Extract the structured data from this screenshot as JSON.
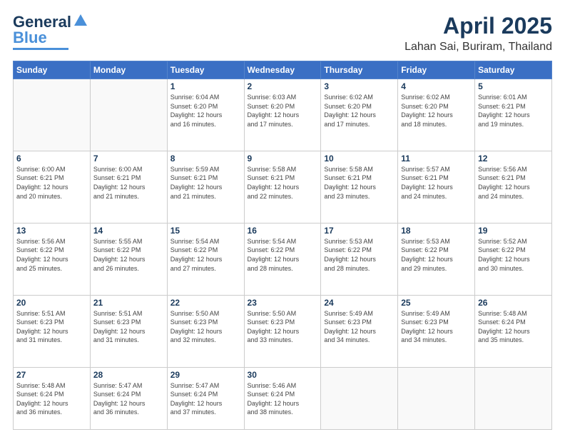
{
  "header": {
    "logo_line1": "General",
    "logo_line2": "Blue",
    "main_title": "April 2025",
    "subtitle": "Lahan Sai, Buriram, Thailand"
  },
  "weekdays": [
    "Sunday",
    "Monday",
    "Tuesday",
    "Wednesday",
    "Thursday",
    "Friday",
    "Saturday"
  ],
  "weeks": [
    {
      "days": [
        {
          "num": "",
          "info": ""
        },
        {
          "num": "",
          "info": ""
        },
        {
          "num": "1",
          "info": "Sunrise: 6:04 AM\nSunset: 6:20 PM\nDaylight: 12 hours\nand 16 minutes."
        },
        {
          "num": "2",
          "info": "Sunrise: 6:03 AM\nSunset: 6:20 PM\nDaylight: 12 hours\nand 17 minutes."
        },
        {
          "num": "3",
          "info": "Sunrise: 6:02 AM\nSunset: 6:20 PM\nDaylight: 12 hours\nand 17 minutes."
        },
        {
          "num": "4",
          "info": "Sunrise: 6:02 AM\nSunset: 6:20 PM\nDaylight: 12 hours\nand 18 minutes."
        },
        {
          "num": "5",
          "info": "Sunrise: 6:01 AM\nSunset: 6:21 PM\nDaylight: 12 hours\nand 19 minutes."
        }
      ]
    },
    {
      "days": [
        {
          "num": "6",
          "info": "Sunrise: 6:00 AM\nSunset: 6:21 PM\nDaylight: 12 hours\nand 20 minutes."
        },
        {
          "num": "7",
          "info": "Sunrise: 6:00 AM\nSunset: 6:21 PM\nDaylight: 12 hours\nand 21 minutes."
        },
        {
          "num": "8",
          "info": "Sunrise: 5:59 AM\nSunset: 6:21 PM\nDaylight: 12 hours\nand 21 minutes."
        },
        {
          "num": "9",
          "info": "Sunrise: 5:58 AM\nSunset: 6:21 PM\nDaylight: 12 hours\nand 22 minutes."
        },
        {
          "num": "10",
          "info": "Sunrise: 5:58 AM\nSunset: 6:21 PM\nDaylight: 12 hours\nand 23 minutes."
        },
        {
          "num": "11",
          "info": "Sunrise: 5:57 AM\nSunset: 6:21 PM\nDaylight: 12 hours\nand 24 minutes."
        },
        {
          "num": "12",
          "info": "Sunrise: 5:56 AM\nSunset: 6:21 PM\nDaylight: 12 hours\nand 24 minutes."
        }
      ]
    },
    {
      "days": [
        {
          "num": "13",
          "info": "Sunrise: 5:56 AM\nSunset: 6:22 PM\nDaylight: 12 hours\nand 25 minutes."
        },
        {
          "num": "14",
          "info": "Sunrise: 5:55 AM\nSunset: 6:22 PM\nDaylight: 12 hours\nand 26 minutes."
        },
        {
          "num": "15",
          "info": "Sunrise: 5:54 AM\nSunset: 6:22 PM\nDaylight: 12 hours\nand 27 minutes."
        },
        {
          "num": "16",
          "info": "Sunrise: 5:54 AM\nSunset: 6:22 PM\nDaylight: 12 hours\nand 28 minutes."
        },
        {
          "num": "17",
          "info": "Sunrise: 5:53 AM\nSunset: 6:22 PM\nDaylight: 12 hours\nand 28 minutes."
        },
        {
          "num": "18",
          "info": "Sunrise: 5:53 AM\nSunset: 6:22 PM\nDaylight: 12 hours\nand 29 minutes."
        },
        {
          "num": "19",
          "info": "Sunrise: 5:52 AM\nSunset: 6:22 PM\nDaylight: 12 hours\nand 30 minutes."
        }
      ]
    },
    {
      "days": [
        {
          "num": "20",
          "info": "Sunrise: 5:51 AM\nSunset: 6:23 PM\nDaylight: 12 hours\nand 31 minutes."
        },
        {
          "num": "21",
          "info": "Sunrise: 5:51 AM\nSunset: 6:23 PM\nDaylight: 12 hours\nand 31 minutes."
        },
        {
          "num": "22",
          "info": "Sunrise: 5:50 AM\nSunset: 6:23 PM\nDaylight: 12 hours\nand 32 minutes."
        },
        {
          "num": "23",
          "info": "Sunrise: 5:50 AM\nSunset: 6:23 PM\nDaylight: 12 hours\nand 33 minutes."
        },
        {
          "num": "24",
          "info": "Sunrise: 5:49 AM\nSunset: 6:23 PM\nDaylight: 12 hours\nand 34 minutes."
        },
        {
          "num": "25",
          "info": "Sunrise: 5:49 AM\nSunset: 6:23 PM\nDaylight: 12 hours\nand 34 minutes."
        },
        {
          "num": "26",
          "info": "Sunrise: 5:48 AM\nSunset: 6:24 PM\nDaylight: 12 hours\nand 35 minutes."
        }
      ]
    },
    {
      "days": [
        {
          "num": "27",
          "info": "Sunrise: 5:48 AM\nSunset: 6:24 PM\nDaylight: 12 hours\nand 36 minutes."
        },
        {
          "num": "28",
          "info": "Sunrise: 5:47 AM\nSunset: 6:24 PM\nDaylight: 12 hours\nand 36 minutes."
        },
        {
          "num": "29",
          "info": "Sunrise: 5:47 AM\nSunset: 6:24 PM\nDaylight: 12 hours\nand 37 minutes."
        },
        {
          "num": "30",
          "info": "Sunrise: 5:46 AM\nSunset: 6:24 PM\nDaylight: 12 hours\nand 38 minutes."
        },
        {
          "num": "",
          "info": ""
        },
        {
          "num": "",
          "info": ""
        },
        {
          "num": "",
          "info": ""
        }
      ]
    }
  ]
}
